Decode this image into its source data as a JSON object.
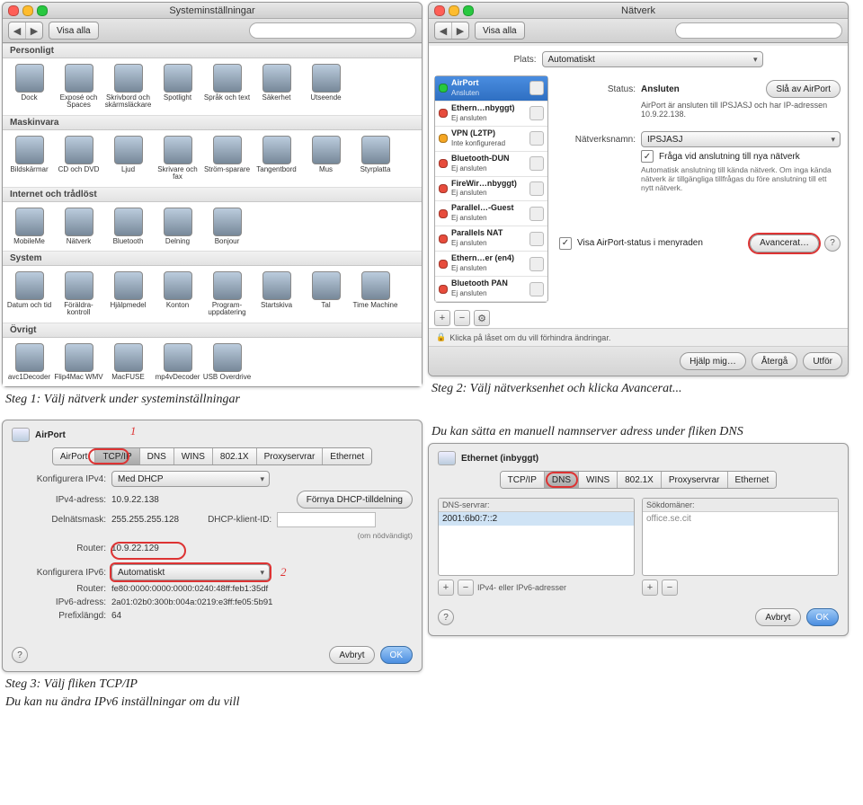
{
  "captions": {
    "s1": "Steg 1: Välj nätverk under systeminställningar",
    "s2": "Steg 2: Välj nätverksenhet och klicka Avancerat...",
    "s3a": "Steg 3: Välj fliken TCP/IP",
    "s3b": "Du kan nu ändra IPv6 inställningar om du vill",
    "s4": "Du kan sätta en manuell namnserver adress under fliken DNS"
  },
  "common": {
    "showall": "Visa alla",
    "search_ph": "",
    "back": "◀",
    "fwd": "▶",
    "help": "?",
    "cancel": "Avbryt",
    "ok": "OK"
  },
  "ss1": {
    "title": "Systeminställningar",
    "sections": [
      {
        "h": "Personligt",
        "items": [
          "Dock",
          "Exposé och Spaces",
          "Skrivbord och skärmsläckare",
          "Spotlight",
          "Språk och text",
          "Säkerhet",
          "Utseende"
        ]
      },
      {
        "h": "Maskinvara",
        "items": [
          "Bildskärmar",
          "CD och DVD",
          "Ljud",
          "Skrivare och fax",
          "Ström-sparare",
          "Tangentbord",
          "Mus",
          "Styrplatta"
        ]
      },
      {
        "h": "Internet och trådlöst",
        "items": [
          "MobileMe",
          "Nätverk",
          "Bluetooth",
          "Delning",
          "Bonjour"
        ]
      },
      {
        "h": "System",
        "items": [
          "Datum och tid",
          "Föräldra-kontroll",
          "Hjälpmedel",
          "Konton",
          "Program-uppdatering",
          "Startskiva",
          "Tal",
          "Time Machine"
        ]
      },
      {
        "h": "Övrigt",
        "items": [
          "avc1Decoder",
          "Flip4Mac WMV",
          "MacFUSE",
          "mp4vDecoder",
          "USB Overdrive"
        ]
      }
    ]
  },
  "ss2": {
    "title": "Nätverk",
    "plats_label": "Plats:",
    "plats": "Automatiskt",
    "status_label": "Status:",
    "status": "Ansluten",
    "off_btn": "Slå av AirPort",
    "status_desc": "AirPort är ansluten till IPSJASJ och har IP-adressen 10.9.22.138.",
    "name_label": "Nätverksnamn:",
    "name_val": "IPSJASJ",
    "ask_label": "Fråga vid anslutning till nya nätverk",
    "ask_desc": "Automatisk anslutning till kända nätverk. Om inga kända nätverk är tillgängliga tillfrågas du före anslutning till ett nytt nätverk.",
    "menubar": "Visa AirPort-status i menyraden",
    "adv": "Avancerat…",
    "lock": "Klicka på låset om du vill förhindra ändringar.",
    "ftr": {
      "help": "Hjälp mig…",
      "revert": "Återgå",
      "apply": "Utför"
    },
    "ifaces": [
      {
        "n": "AirPort",
        "s": "Ansluten",
        "c": "green",
        "sel": true,
        "ic": "wifi"
      },
      {
        "n": "Ethern…nbyggt)",
        "s": "Ej ansluten",
        "c": "red",
        "ic": "eth"
      },
      {
        "n": "VPN (L2TP)",
        "s": "Inte konfigurerad",
        "c": "none",
        "ic": "lock"
      },
      {
        "n": "Bluetooth-DUN",
        "s": "Ej ansluten",
        "c": "red",
        "ic": "bt"
      },
      {
        "n": "FireWir…nbyggt)",
        "s": "Ej ansluten",
        "c": "red",
        "ic": "fw"
      },
      {
        "n": "Parallel…-Guest",
        "s": "Ej ansluten",
        "c": "red",
        "ic": "eth"
      },
      {
        "n": "Parallels NAT",
        "s": "Ej ansluten",
        "c": "red",
        "ic": "eth"
      },
      {
        "n": "Ethern…er (en4)",
        "s": "Ej ansluten",
        "c": "red",
        "ic": "eth"
      },
      {
        "n": "Bluetooth PAN",
        "s": "Ej ansluten",
        "c": "red",
        "ic": "bt"
      }
    ]
  },
  "ss3": {
    "title": "AirPort",
    "badge": "1",
    "badge2": "2",
    "tabs": [
      "AirPort",
      "TCP/IP",
      "DNS",
      "WINS",
      "802.1X",
      "Proxyservrar",
      "Ethernet"
    ],
    "rows": {
      "cfg4_l": "Konfigurera IPv4:",
      "cfg4_v": "Med DHCP",
      "ip_l": "IPv4-adress:",
      "ip_v": "10.9.22.138",
      "renew": "Förnya DHCP-tilldelning",
      "mask_l": "Delnätsmask:",
      "mask_v": "255.255.255.128",
      "dhcpid_l": "DHCP-klient-ID:",
      "dhcpid_hint": "(om nödvändigt)",
      "router_l": "Router:",
      "router_v": "10.9.22.129",
      "cfg6_l": "Konfigurera IPv6:",
      "cfg6_v": "Automatiskt",
      "router6_l": "Router:",
      "router6_v": "fe80:0000:0000:0000:0240:48ff:feb1:35df",
      "ip6_l": "IPv6-adress:",
      "ip6_v": "2a01:02b0:300b:004a:0219:e3ff:fe05:5b91",
      "plen_l": "Prefixlängd:",
      "plen_v": "64"
    }
  },
  "ss4": {
    "title": "Ethernet (inbyggt)",
    "tabs": [
      "TCP/IP",
      "DNS",
      "WINS",
      "802.1X",
      "Proxyservrar",
      "Ethernet"
    ],
    "dns_h": "DNS-servrar:",
    "dom_h": "Sökdomäner:",
    "dns_val": "2001:6b0:7::2",
    "dom_val": "office.se.cit",
    "addr_toggle": "IPv4- eller IPv6-adresser"
  }
}
